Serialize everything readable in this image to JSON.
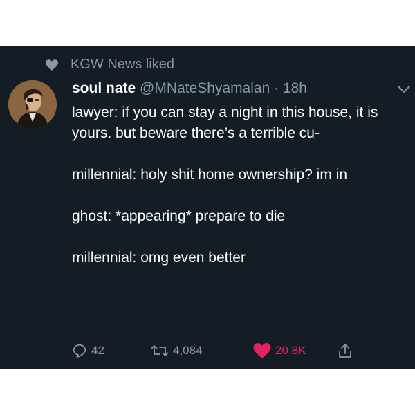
{
  "social_context": {
    "text": "KGW News liked"
  },
  "tweet": {
    "display_name": "soul nate",
    "handle": "@MNateShyamalan",
    "separator": "·",
    "timestamp": "18h",
    "paragraphs": [
      "lawyer: if you can stay a night in this house, it is yours. but beware there’s a terrible cu-",
      "millennial: holy shit home ownership? im in",
      "ghost: *appearing* prepare to die",
      "millennial: omg even better"
    ]
  },
  "actions": {
    "replies": "42",
    "retweets": "4,084",
    "likes": "20.8K",
    "like_color": "#e0245e"
  },
  "colors": {
    "background": "#141d26",
    "muted": "#8899a6",
    "text": "#ffffff"
  },
  "icons": [
    "heart-icon",
    "chevron-down-icon",
    "reply-icon",
    "retweet-icon",
    "heart-filled-icon",
    "share-icon"
  ]
}
